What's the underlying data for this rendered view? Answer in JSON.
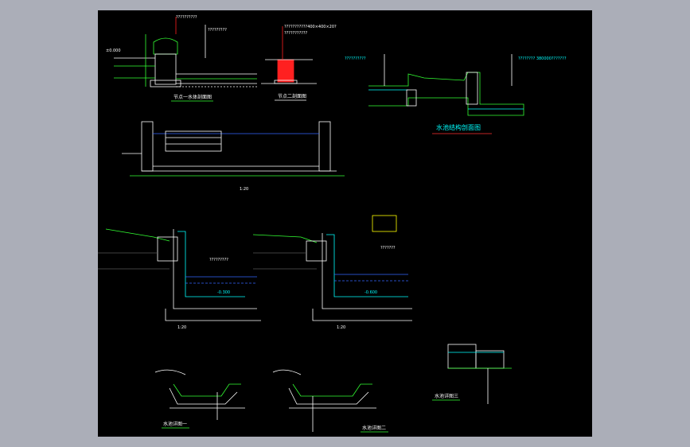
{
  "sheet": {
    "background": "#000000",
    "frame_background": "#abaeb8",
    "colors": {
      "line_white": "#ffffff",
      "line_green": "#33ff33",
      "line_cyan": "#00ffff",
      "line_red": "#ff2020",
      "line_yellow": "#ffff00",
      "water_blue": "#3366ff",
      "underline_red": "#ff3030"
    }
  },
  "labels": {
    "detail_a_title": "节点一水体剖面图",
    "detail_b_title": "节点二剖面图",
    "pool_structure_title": "水池结构剖面图",
    "pool_section_scale": "1:20",
    "mid_left_scale": "1:20",
    "mid_right_scale": "1:20",
    "bottom_left_title": "水池详图一",
    "bottom_mid_title": "水池详图二",
    "bottom_right_title": "水池详图三",
    "leader_a1": "??????????",
    "leader_a2": "?????????",
    "leader_b1": "???????????400×400×20?",
    "leader_b2": "???????????",
    "leader_c1": "??????????",
    "leader_c2": "???????? 380000???????",
    "level_a": "±0.000",
    "level_b": "-0.300",
    "level_c": "-0.600",
    "note_water": "?????????",
    "note_soil": "???????"
  }
}
